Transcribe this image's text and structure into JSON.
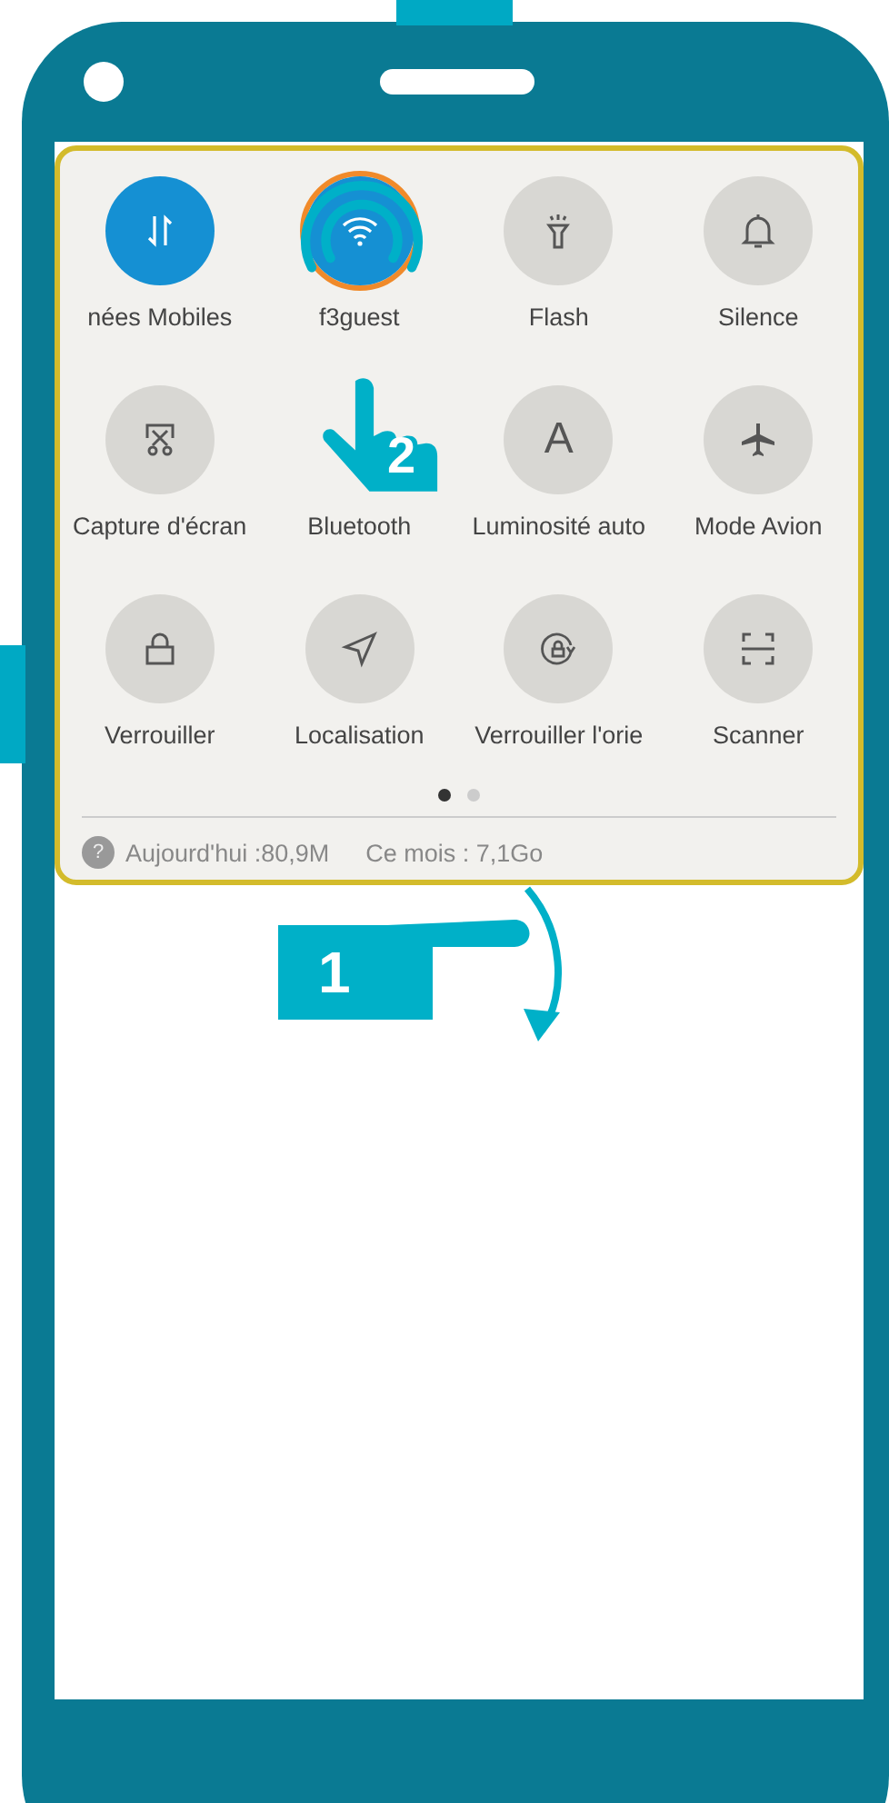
{
  "tiles": [
    {
      "label": "nées Mobiles",
      "on": true,
      "highlighted": false
    },
    {
      "label": "f3guest",
      "on": true,
      "highlighted": true
    },
    {
      "label": "Flash",
      "on": false,
      "highlighted": false
    },
    {
      "label": "Silence",
      "on": false,
      "highlighted": false
    },
    {
      "label": "Capture d'écran",
      "on": false,
      "highlighted": false
    },
    {
      "label": "Bluetooth"
    },
    {
      "label": "Luminosité auto",
      "glyph": "A",
      "on": false,
      "highlighted": false
    },
    {
      "label": "Mode Avion",
      "on": false,
      "highlighted": false
    },
    {
      "label": "Verrouiller",
      "on": false,
      "highlighted": false
    },
    {
      "label": "Localisation",
      "on": false,
      "highlighted": false
    },
    {
      "label": "Verrouiller l'orie",
      "on": false,
      "highlighted": false
    },
    {
      "label": "Scanner",
      "on": false,
      "highlighted": false
    }
  ],
  "pager": [
    {
      "selected": true
    },
    {
      "selected": false
    }
  ],
  "usage": {
    "help": "?",
    "today": "Aujourd'hui :80,9M",
    "month": "Ce mois : 7,1Go"
  },
  "steps": [
    {
      "kind": "tap",
      "number": "2"
    },
    {
      "kind": "swipe",
      "number": "1"
    }
  ]
}
